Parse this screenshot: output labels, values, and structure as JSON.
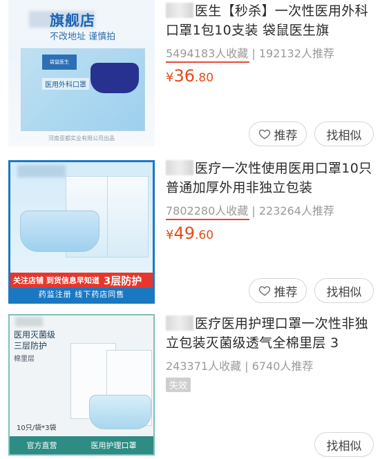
{
  "products": [
    {
      "thumb": {
        "store_name": "旗舰店",
        "store_prefix": "袋",
        "slogan": "不改地址 谨慎拍",
        "pack_label": "医用外科口罩",
        "pack_brand": "袋鼠医生",
        "footer": "河南亚都实业有限公司出品"
      },
      "title_tail": "医生【秒杀】一次性医用外科口罩1包10支装 袋鼠医生旗",
      "favorites": "5494183人收藏",
      "recommends": "192132人推荐",
      "price_currency": "¥",
      "price_int": "36",
      "price_dec": ".80",
      "btn_recommend": "推荐",
      "btn_similar": "找相似"
    },
    {
      "thumb": {
        "red_bar_text": "关注店铺 到货信息早知道",
        "red_bar_big": "3层防护",
        "blue_bar_text": "药监注册  线下药店同售"
      },
      "title_tail": "医疗一次性使用医用口罩10只普通加厚外用非独立包装",
      "favorites": "7802280人收藏",
      "recommends": "223264人推荐",
      "price_currency": "¥",
      "price_int": "49",
      "price_dec": ".60",
      "btn_recommend": "推荐",
      "btn_similar": "找相似"
    },
    {
      "thumb": {
        "line1": "医用灭菌级",
        "line2": "三层防护",
        "line3": "棉里层",
        "count": "10只/袋*3袋",
        "bottom_left": "官方直营",
        "bottom_right": "医用护理口罩"
      },
      "title_tail": "医疗医用护理口罩一次性非独立包装灭菌级透气全棉里层 3",
      "favorites": "243371人收藏",
      "recommends": "6740人推荐",
      "status_badge": "失效",
      "btn_similar": "找相似"
    }
  ],
  "separator": " | ",
  "colors": {
    "price": "#e64a19",
    "underline": "#e24a3b",
    "badge": "#cfcfcf"
  }
}
